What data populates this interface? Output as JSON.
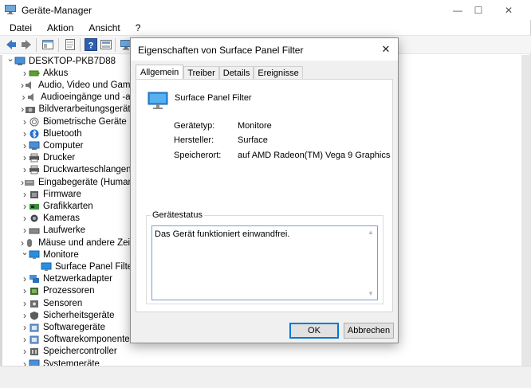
{
  "window": {
    "title": "Geräte-Manager",
    "minimize": "—",
    "maximize": "☐",
    "close": "✕"
  },
  "menu": [
    "Datei",
    "Aktion",
    "Ansicht",
    "?"
  ],
  "tree": {
    "root": "DESKTOP-PKB7D88",
    "items": [
      {
        "label": "Akkus",
        "icon": "battery-icon",
        "expanded": false
      },
      {
        "label": "Audio, Video und Gamec",
        "icon": "speaker-icon",
        "expanded": false
      },
      {
        "label": "Audioeingänge und -au",
        "icon": "speaker-icon",
        "expanded": false
      },
      {
        "label": "Bildverarbeitungsgeräte",
        "icon": "camera-icon",
        "expanded": false
      },
      {
        "label": "Biometrische Geräte",
        "icon": "fingerprint-icon",
        "expanded": false
      },
      {
        "label": "Bluetooth",
        "icon": "bluetooth-icon",
        "expanded": false
      },
      {
        "label": "Computer",
        "icon": "computer-icon",
        "expanded": false
      },
      {
        "label": "Drucker",
        "icon": "printer-icon",
        "expanded": false
      },
      {
        "label": "Druckwarteschlangen",
        "icon": "printer-icon",
        "expanded": false
      },
      {
        "label": "Eingabegeräte (Human I",
        "icon": "hid-icon",
        "expanded": false
      },
      {
        "label": "Firmware",
        "icon": "firmware-icon",
        "expanded": false
      },
      {
        "label": "Grafikkarten",
        "icon": "display-adapter-icon",
        "expanded": false
      },
      {
        "label": "Kameras",
        "icon": "webcam-icon",
        "expanded": false
      },
      {
        "label": "Laufwerke",
        "icon": "drive-icon",
        "expanded": false
      },
      {
        "label": "Mäuse und andere Zeige",
        "icon": "mouse-icon",
        "expanded": false
      },
      {
        "label": "Monitore",
        "icon": "monitor-icon",
        "expanded": true
      },
      {
        "label": "Surface Panel Filter",
        "icon": "monitor-icon",
        "child": true
      },
      {
        "label": "Netzwerkadapter",
        "icon": "network-icon",
        "expanded": false
      },
      {
        "label": "Prozessoren",
        "icon": "processor-icon",
        "expanded": false
      },
      {
        "label": "Sensoren",
        "icon": "sensor-icon",
        "expanded": false
      },
      {
        "label": "Sicherheitsgeräte",
        "icon": "security-icon",
        "expanded": false
      },
      {
        "label": "Softwaregeräte",
        "icon": "software-icon",
        "expanded": false
      },
      {
        "label": "Softwarekomponenten",
        "icon": "software-icon",
        "expanded": false
      },
      {
        "label": "Speichercontroller",
        "icon": "storage-icon",
        "expanded": false
      },
      {
        "label": "Systemgeräte",
        "icon": "system-icon",
        "expanded": false
      }
    ]
  },
  "dialog": {
    "title": "Eigenschaften von Surface Panel Filter",
    "close": "✕",
    "tabs": [
      "Allgemein",
      "Treiber",
      "Details",
      "Ereignisse"
    ],
    "device_name": "Surface Panel Filter",
    "properties": [
      {
        "label": "Gerätetyp:",
        "value": "Monitore"
      },
      {
        "label": "Hersteller:",
        "value": "Surface"
      },
      {
        "label": "Speicherort:",
        "value": "auf AMD Radeon(TM) Vega 9 Graphics"
      }
    ],
    "status_legend": "Gerätestatus",
    "status_text": "Das Gerät funktioniert einwandfrei.",
    "ok": "OK",
    "cancel": "Abbrechen"
  },
  "colors": {
    "accent": "#0078d7",
    "monitor_blue": "#1e88d6"
  }
}
